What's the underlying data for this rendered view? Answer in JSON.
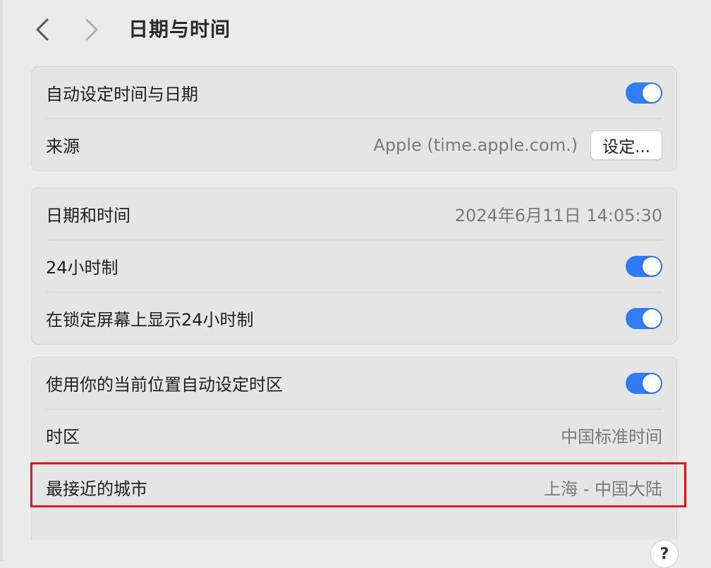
{
  "header": {
    "title": "日期与时间",
    "back_icon": "chevron-left-icon",
    "forward_icon": "chevron-right-icon"
  },
  "group_auto": {
    "auto_set_label": "自动设定时间与日期",
    "auto_set_enabled": true,
    "source_label": "来源",
    "source_value": "Apple (time.apple.com.)",
    "set_button_label": "设定..."
  },
  "group_datetime": {
    "datetime_label": "日期和时间",
    "datetime_value": "2024年6月11日 14:05:30",
    "hour24_label": "24小时制",
    "hour24_enabled": true,
    "lockscreen24_label": "在锁定屏幕上显示24小时制",
    "lockscreen24_enabled": true
  },
  "group_timezone": {
    "auto_tz_label": "使用你的当前位置自动设定时区",
    "auto_tz_enabled": true,
    "timezone_label": "时区",
    "timezone_value": "中国标准时间",
    "city_label": "最接近的城市",
    "city_value": "上海 - 中国大陆"
  },
  "help": {
    "label": "?"
  },
  "colors": {
    "accent": "#2f7cf6",
    "highlight": "#e0151b"
  }
}
